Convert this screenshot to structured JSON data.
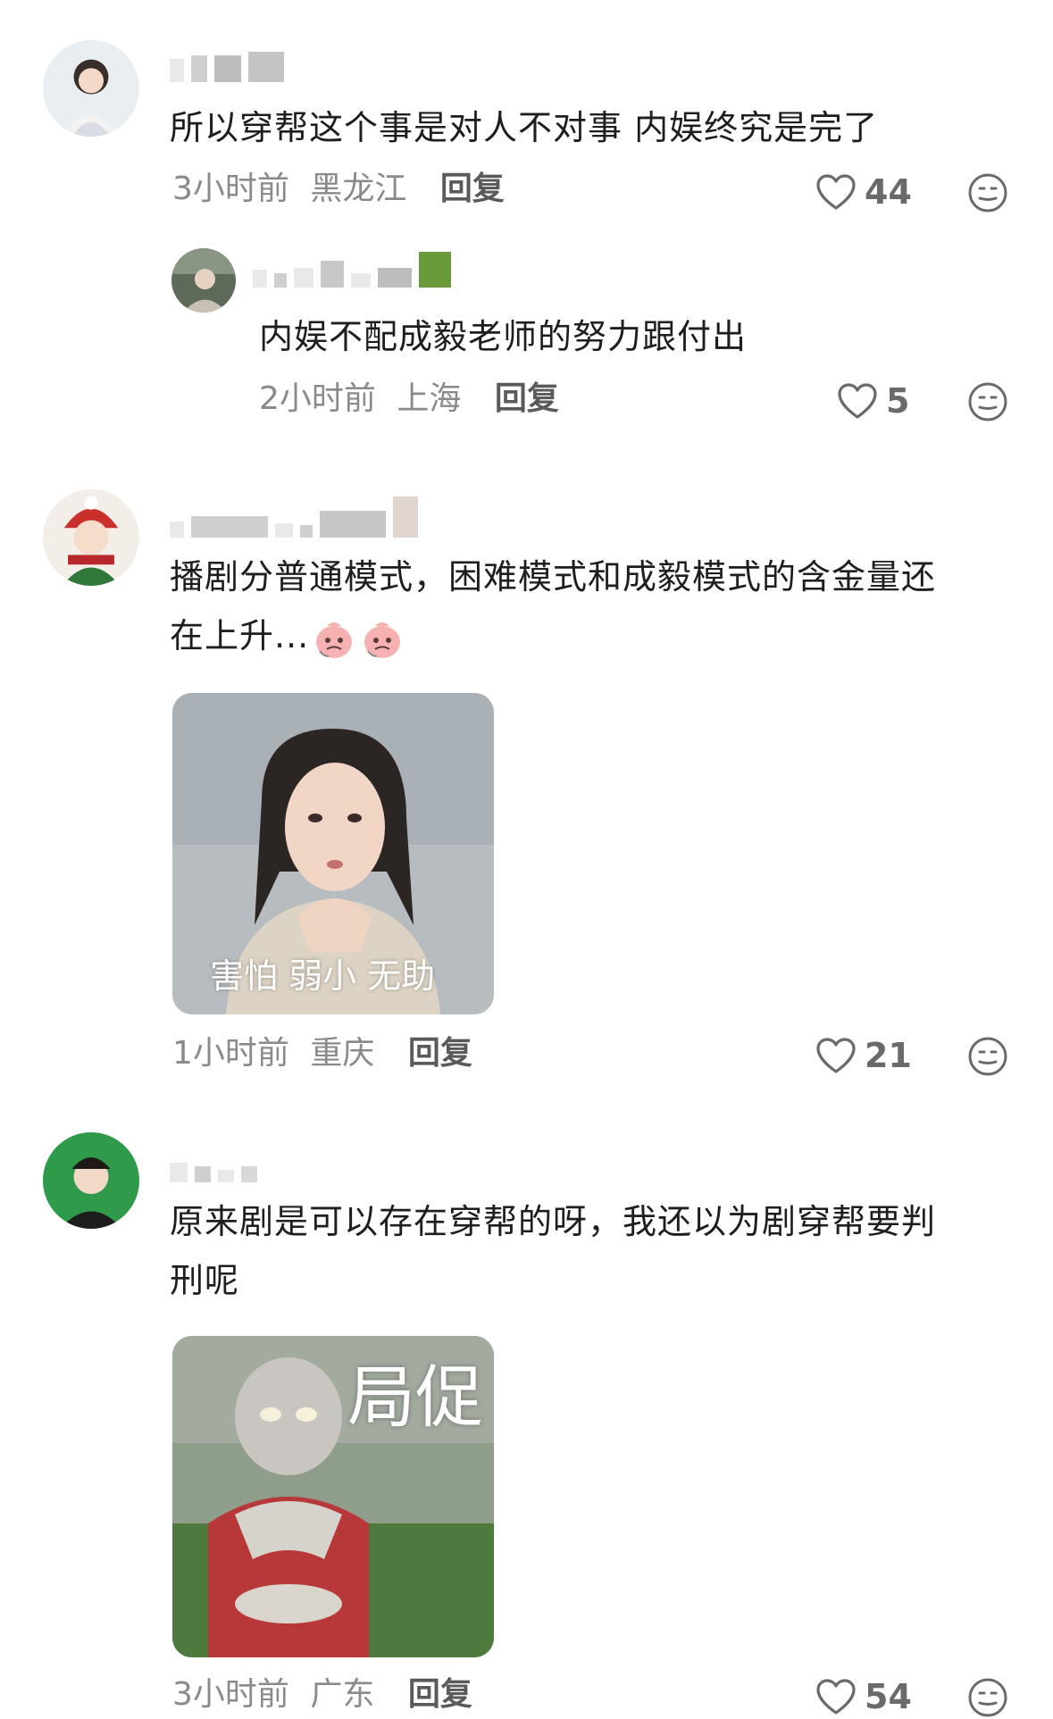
{
  "comments": [
    {
      "text": "所以穿帮这个事是对人不对事  内娱终究是完了",
      "time": "3小时前",
      "location": "黑龙江",
      "reply_label": "回复",
      "likes": "44",
      "reply": {
        "text": "内娱不配成毅老师的努力跟付出",
        "time": "2小时前",
        "location": "上海",
        "reply_label": "回复",
        "likes": "5"
      }
    },
    {
      "text_line1": "播剧分普通模式，困难模式和成毅模式的含金量还",
      "text_line2": "在上升...",
      "sticker_caption": "害怕 弱小 无助",
      "time": "1小时前",
      "location": "重庆",
      "reply_label": "回复",
      "likes": "21"
    },
    {
      "text_line1": "原来剧是可以存在穿帮的呀，我还以为剧穿帮要判",
      "text_line2": "刑呢",
      "sticker_caption": "局促",
      "time": "3小时前",
      "location": "广东",
      "reply_label": "回复",
      "likes": "54"
    }
  ],
  "icons": {
    "like": "heart-outline-icon",
    "emoji_reaction": "smiley-face-icon"
  },
  "colors": {
    "meta_text": "#8a8a8a",
    "body_text": "#1e1e1e",
    "icon_stroke": "#6a6a6a"
  }
}
